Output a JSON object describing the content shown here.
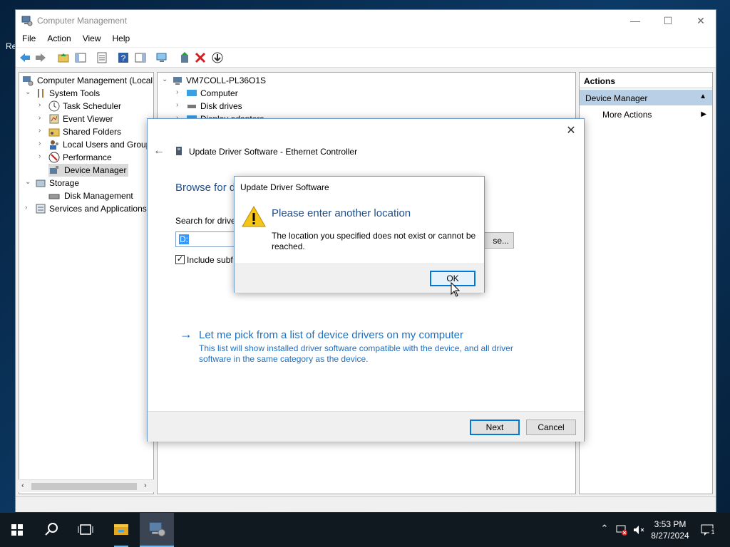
{
  "desktop": {
    "label": "Re"
  },
  "window": {
    "title": "Computer Management",
    "minimize": "—",
    "maximize": "☐",
    "close": "✕"
  },
  "menu": [
    "File",
    "Action",
    "View",
    "Help"
  ],
  "tree": {
    "root": "Computer Management (Local",
    "system_tools": "System Tools",
    "task_scheduler": "Task Scheduler",
    "event_viewer": "Event Viewer",
    "shared_folders": "Shared Folders",
    "local_users": "Local Users and Group",
    "performance": "Performance",
    "device_manager": "Device Manager",
    "storage": "Storage",
    "disk_management": "Disk Management",
    "services": "Services and Applications"
  },
  "devices": {
    "root": "VM7COLL-PL36O1S",
    "items": [
      "Computer",
      "Disk drives",
      "Display adapters"
    ]
  },
  "actions": {
    "header": "Actions",
    "section": "Device Manager",
    "more": "More Actions"
  },
  "update_dialog": {
    "title": "Update Driver Software - Ethernet Controller",
    "heading": "Browse for d",
    "search_label": "Search for drive",
    "path_value": "D:",
    "browse_label": "se...",
    "include_subfolders": "Include subf",
    "pick_link": "Let me pick from a list of device drivers on my computer",
    "pick_desc": "This list will show installed driver software compatible with the device, and all driver software in the same category as the device.",
    "next": "Next",
    "cancel": "Cancel"
  },
  "message_box": {
    "title": "Update Driver Software",
    "heading": "Please enter another location",
    "body": "The location you specified does not exist or cannot be reached.",
    "ok": "OK"
  },
  "taskbar": {
    "time": "3:53 PM",
    "date": "8/27/2024",
    "notifications": "1"
  }
}
